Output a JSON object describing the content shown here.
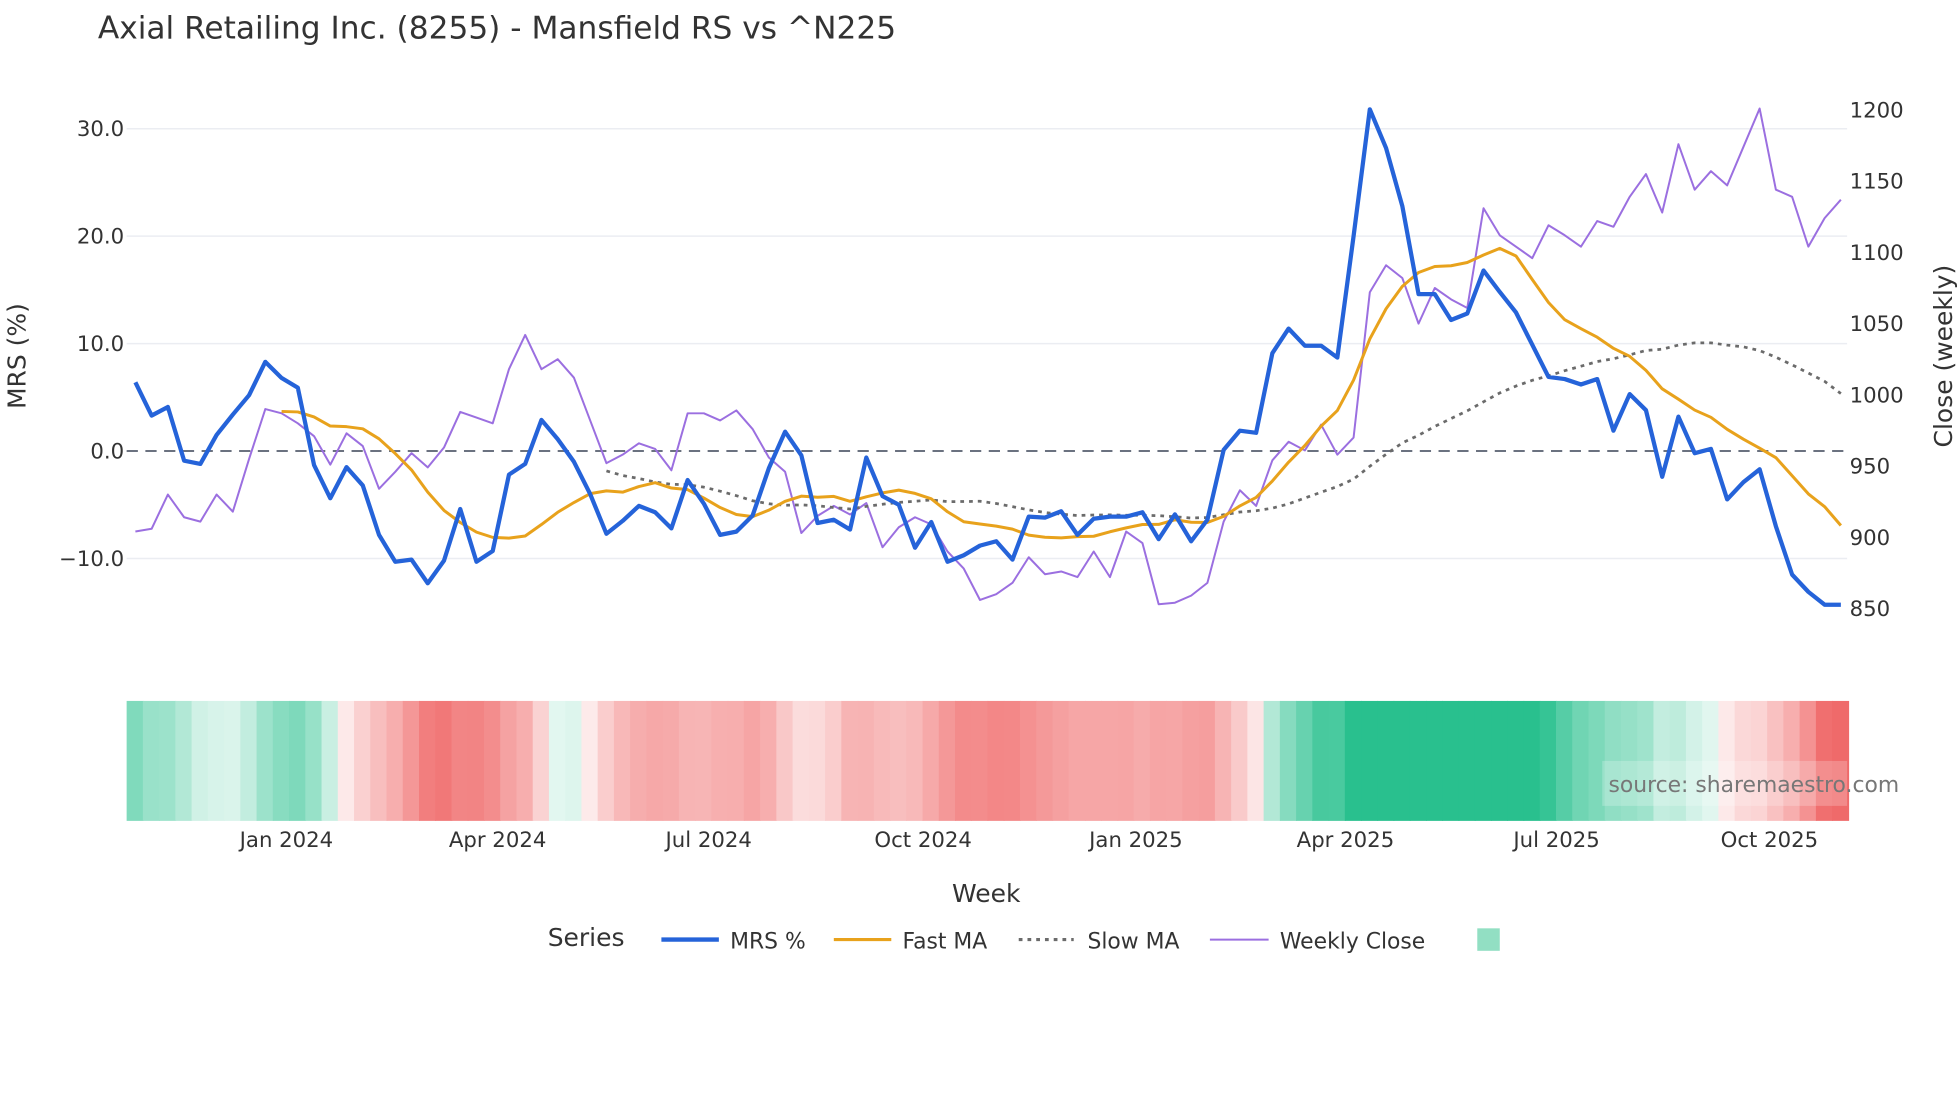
{
  "chart_data": {
    "type": "line",
    "title": "Axial Retailing Inc. (8255) - Mansfield RS vs ^N225",
    "xlabel": "Week",
    "ylabel_left": "MRS (%)",
    "ylabel_right": "Close (weekly)",
    "ylim_left": [
      -14.5,
      33
    ],
    "ylim_right": [
      840,
      1210
    ],
    "x_start": "2023-10-27",
    "x_frequency": "weekly",
    "x_tick_labels": [
      "Jan 2024",
      "Apr 2024",
      "Jul 2024",
      "Oct 2024",
      "Jan 2025",
      "Apr 2025",
      "Jul 2025",
      "Oct 2025"
    ],
    "x_tick_week_index": [
      9.3,
      22.3,
      35.3,
      48.5,
      61.6,
      74.5,
      87.5,
      100.6
    ],
    "y_left_ticks": [
      30,
      20,
      10,
      0,
      -10
    ],
    "y_left_tick_labels": [
      "30.0",
      "20.0",
      "10.0",
      "0.0",
      "−10.0"
    ],
    "y_right_ticks": [
      1200,
      1150,
      1100,
      1050,
      1000,
      950,
      900,
      850
    ],
    "y_right_tick_labels": [
      "1200",
      "1150",
      "1100",
      "1050",
      "1000",
      "950",
      "900",
      "850"
    ],
    "grid": true,
    "zero_line": "dashed",
    "legend_title": "Series",
    "legend_placement": "bottom-center",
    "series": [
      {
        "name": "MRS %",
        "axis": "left",
        "color": "#2563d9",
        "style": "solid",
        "values": [
          6.4,
          3.3,
          4.1,
          -0.9,
          -1.2,
          1.5,
          3.4,
          5.2,
          8.3,
          6.8,
          5.9,
          -1.3,
          -4.4,
          -1.5,
          -3.2,
          -7.8,
          -10.3,
          -10.1,
          -12.3,
          -10.2,
          -5.4,
          -10.3,
          -9.3,
          -2.2,
          -1.2,
          2.9,
          1.1,
          -1.0,
          -4.0,
          -7.7,
          -6.5,
          -5.1,
          -5.7,
          -7.2,
          -2.7,
          -4.9,
          -7.8,
          -7.5,
          -6.0,
          -1.6,
          1.8,
          -0.4,
          -6.7,
          -6.4,
          -7.3,
          -0.6,
          -4.2,
          -5.0,
          -9.0,
          -6.6,
          -10.3,
          -9.7,
          -8.8,
          -8.4,
          -10.1,
          -6.1,
          -6.2,
          -5.6,
          -7.8,
          -6.3,
          -6.1,
          -6.1,
          -5.7,
          -8.2,
          -5.9,
          -8.4,
          -6.4,
          0.1,
          1.9,
          1.7,
          9.1,
          11.4,
          9.8,
          9.8,
          8.7,
          20.0,
          31.8,
          28.2,
          22.8,
          14.6,
          14.6,
          12.2,
          12.8,
          16.8,
          14.8,
          12.9,
          9.9,
          6.9,
          6.7,
          6.2,
          6.7,
          1.9,
          5.3,
          3.8,
          -2.4,
          3.2,
          -0.2,
          0.2,
          -4.5,
          -2.9,
          -1.7,
          -7.0,
          -11.5,
          -13.1,
          -14.3,
          -14.3
        ]
      },
      {
        "name": "Fast MA",
        "axis": "left",
        "color": "#e8a21c",
        "style": "solid",
        "window": 10,
        "source": "MRS %"
      },
      {
        "name": "Slow MA",
        "axis": "left",
        "color": "#6b6b6b",
        "style": "dotted",
        "window": 30,
        "source": "MRS %"
      },
      {
        "name": "Weekly Close",
        "axis": "right",
        "color": "#9b6fe0",
        "style": "solid",
        "values": [
          904,
          906,
          930,
          914,
          911,
          930,
          918,
          955,
          990,
          987,
          980,
          971,
          951,
          973,
          964,
          934,
          946,
          959,
          949,
          963,
          988,
          984,
          980,
          1018,
          1042,
          1018,
          1025,
          1012,
          982,
          952,
          958,
          966,
          962,
          947,
          987,
          987,
          982,
          989,
          976,
          956,
          946,
          903,
          915,
          922,
          916,
          924,
          893,
          907,
          914,
          909,
          890,
          878,
          856,
          860,
          868,
          886,
          874,
          876,
          872,
          890,
          872,
          904,
          896,
          853,
          854,
          859,
          868,
          911,
          933,
          922,
          954,
          967,
          961,
          979,
          958,
          970,
          1072,
          1091,
          1082,
          1050,
          1075,
          1067,
          1061,
          1131,
          1112,
          1104,
          1096,
          1119,
          1112,
          1104,
          1122,
          1118,
          1139,
          1155,
          1128,
          1176,
          1144,
          1157,
          1147,
          1174,
          1201,
          1144,
          1139,
          1104,
          1124,
          1137
        ]
      }
    ],
    "heatmap": {
      "source": "MRS %",
      "smoothing_window": 4,
      "positive_color": "#22be8a",
      "negative_color": "#ef6565",
      "legend_swatch_color": "#92dfc3"
    }
  },
  "watermark": "source: sharemaestro.com"
}
